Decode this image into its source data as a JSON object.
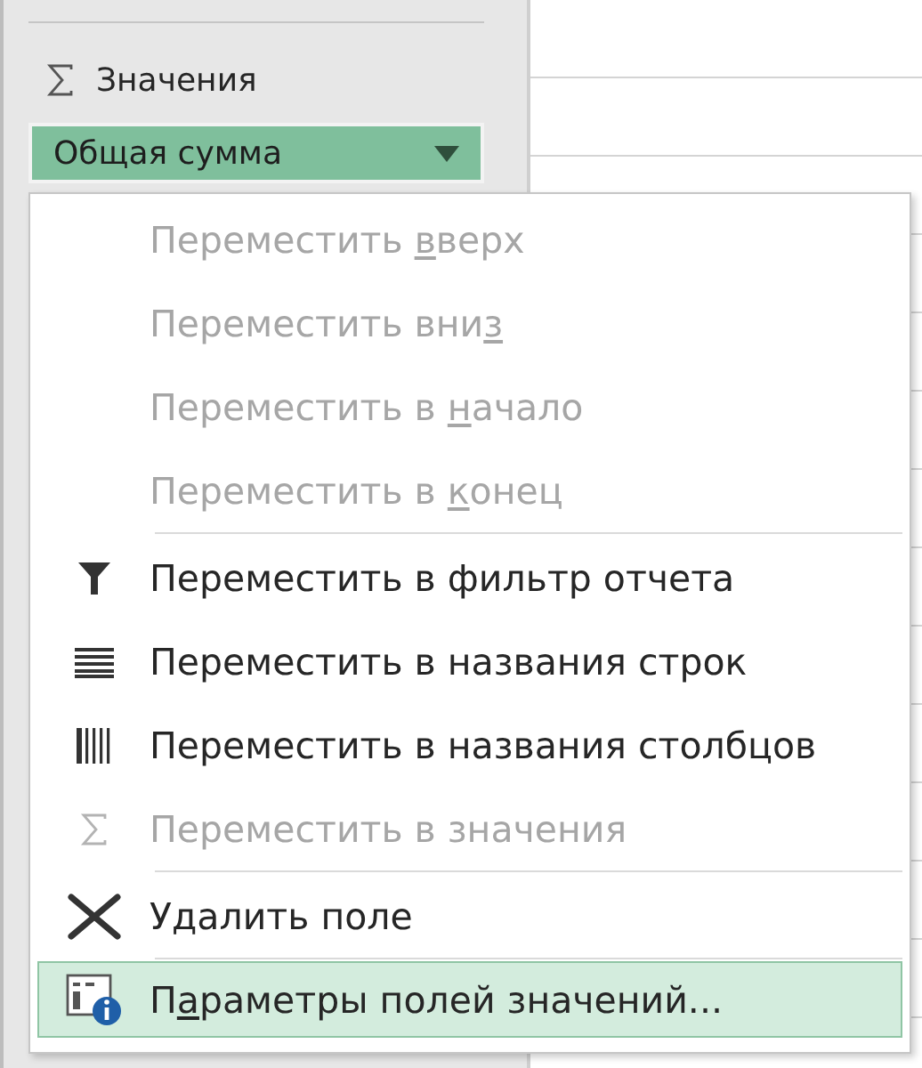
{
  "values_area": {
    "title": "Значения",
    "field": {
      "label": "Общая сумма",
      "open": true
    }
  },
  "menu": {
    "items": [
      {
        "kind": "none",
        "text_before": "Переместить ",
        "hotkey": "в",
        "text_after": "верх",
        "disabled": true,
        "selected": false,
        "separator_before": false
      },
      {
        "kind": "none",
        "text_before": "Переместить вни",
        "hotkey": "з",
        "disabled": true,
        "selected": false,
        "separator_before": false
      },
      {
        "kind": "none",
        "text_before": "Переместить в ",
        "hotkey": "н",
        "text_after": "ачало",
        "disabled": true,
        "selected": false,
        "separator_before": false
      },
      {
        "kind": "none",
        "text_before": "Переместить в ",
        "hotkey": "к",
        "text_after": "онец",
        "disabled": true,
        "selected": false,
        "separator_before": false
      },
      {
        "kind": "filter",
        "text_before": "Переместить в фильтр отчета",
        "disabled": false,
        "selected": false,
        "separator_before": true
      },
      {
        "kind": "rows",
        "text_before": "Переместить в названия строк",
        "disabled": false,
        "selected": false,
        "separator_before": false
      },
      {
        "kind": "columns",
        "text_before": "Переместить в названия столбцов",
        "disabled": false,
        "selected": false,
        "separator_before": false
      },
      {
        "kind": "sigma",
        "text_before": "Переместить в значения",
        "disabled": true,
        "selected": false,
        "separator_before": false
      },
      {
        "kind": "delete",
        "text_before": "Удалить поле",
        "disabled": false,
        "selected": false,
        "separator_before": true
      },
      {
        "kind": "settings",
        "text_before": "П",
        "hotkey": "а",
        "text_after": "раметры полей значений...",
        "disabled": false,
        "selected": true,
        "separator_before": true
      }
    ]
  }
}
